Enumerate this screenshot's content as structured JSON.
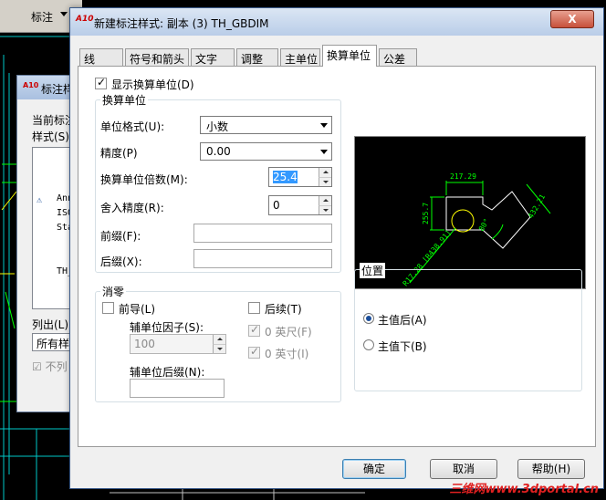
{
  "background": {
    "toolbar_label": "标注",
    "dialog_title": "标注样",
    "current_style_label": "当前标注",
    "styles_label": "样式(S)",
    "style_items": [
      "Anno",
      "ISO",
      "Sta",
      "TH_"
    ],
    "list_label": "列出(L)",
    "list_value": "所有样",
    "no_list_checkbox": "不列"
  },
  "dialog": {
    "title": "新建标注样式: 副本 (3) TH_GBDIM",
    "close_label": "X"
  },
  "tabs": [
    {
      "label": "线"
    },
    {
      "label": "符号和箭头"
    },
    {
      "label": "文字"
    },
    {
      "label": "调整"
    },
    {
      "label": "主单位"
    },
    {
      "label": "换算单位",
      "active": true
    },
    {
      "label": "公差"
    }
  ],
  "alt_units": {
    "display_checkbox_label": "显示换算单位(D)",
    "display_checked": true,
    "group_title": "换算单位",
    "unit_format_label": "单位格式(U):",
    "unit_format_value": "小数",
    "precision_label": "精度(P)",
    "precision_value": "0.00",
    "multiplier_label": "换算单位倍数(M):",
    "multiplier_value": "25.4",
    "round_label": "舍入精度(R):",
    "round_value": "0",
    "prefix_label": "前缀(F):",
    "prefix_value": "",
    "suffix_label": "后缀(X):",
    "suffix_value": ""
  },
  "zero_suppression": {
    "group_title": "消零",
    "leading_label": "前导(L)",
    "leading_checked": false,
    "sub_factor_label": "辅单位因子(S):",
    "sub_factor_value": "100",
    "sub_suffix_label": "辅单位后缀(N):",
    "sub_suffix_value": "",
    "trailing_label": "后续(T)",
    "trailing_checked": false,
    "feet_label": "0 英尺(F)",
    "feet_checked": true,
    "inches_label": "0 英寸(I)",
    "inches_checked": true
  },
  "placement": {
    "group_title": "位置",
    "after_label": "主值后(A)",
    "below_label": "主值下(B)",
    "selected": "after"
  },
  "preview": {
    "dim_top": "217.29",
    "dim_left": "255.7",
    "dim_right": "432.21",
    "dim_angle": "80°",
    "dim_radius": "R17.28 [R438.91]",
    "colors": {
      "geometry": "#ffffff",
      "dimension": "#00ff00",
      "dimtext": "#00ff00",
      "circle": "#ffff00"
    }
  },
  "buttons": {
    "ok": "确定",
    "cancel": "取消",
    "help": "帮助(H)"
  },
  "watermark": "三维网www.3dportal.cn"
}
